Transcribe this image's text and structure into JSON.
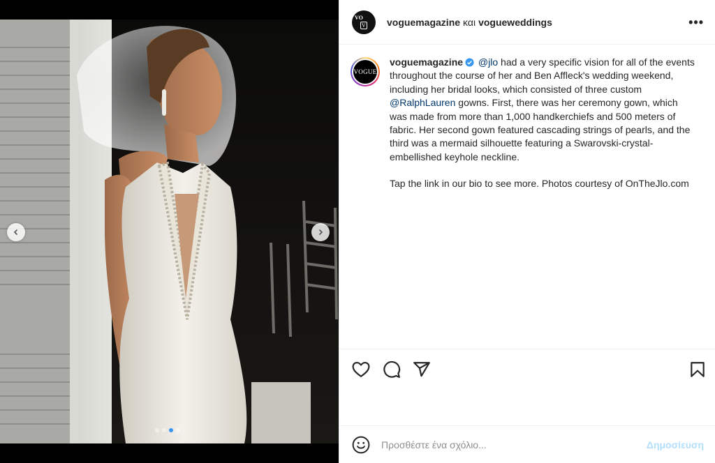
{
  "header": {
    "author": "voguemagazine",
    "conjunction": "και",
    "coauthor": "vogueweddings",
    "more_icon": "more-horizontal-icon",
    "avatar_text_top": "VO",
    "avatar_text_bottom": "VOGUE"
  },
  "caption": {
    "avatar_logo": "VOGUE",
    "username": "voguemagazine",
    "verified_icon": "verified-badge-icon",
    "mention1": "@jlo",
    "text1": " had a very specific vision for all of the events throughout the course of her and Ben Affleck's wedding weekend, including her bridal looks, which consisted of three custom ",
    "mention2": "@RalphLauren",
    "text2": " gowns. First, there was her ceremony gown, which was made from more than 1,000 handkerchiefs and 500 meters of fabric. Her second gown featured cascading strings of pearls, and the third was a mermaid silhouette featuring a Swarovski-crystal-embellished keyhole neckline.",
    "paragraph2": "Tap the link in our bio to see more. Photos courtesy of OnTheJlo.com"
  },
  "carousel": {
    "prev_icon": "chevron-left-icon",
    "next_icon": "chevron-right-icon",
    "slides": 4,
    "active_slide": 3,
    "active_color": "#3897f0"
  },
  "actions": {
    "like_icon": "heart-icon",
    "comment_icon": "comment-bubble-icon",
    "share_icon": "paper-plane-icon",
    "save_icon": "bookmark-icon"
  },
  "comment_bar": {
    "emoji_icon": "smiley-icon",
    "placeholder": "Προσθέστε ένα σχόλιο...",
    "post_label": "Δημοσίευση",
    "post_color": "#b2dffc"
  },
  "colors": {
    "mention": "#00376b",
    "text": "#262626",
    "border": "#efefef",
    "verified": "#3897f0"
  }
}
